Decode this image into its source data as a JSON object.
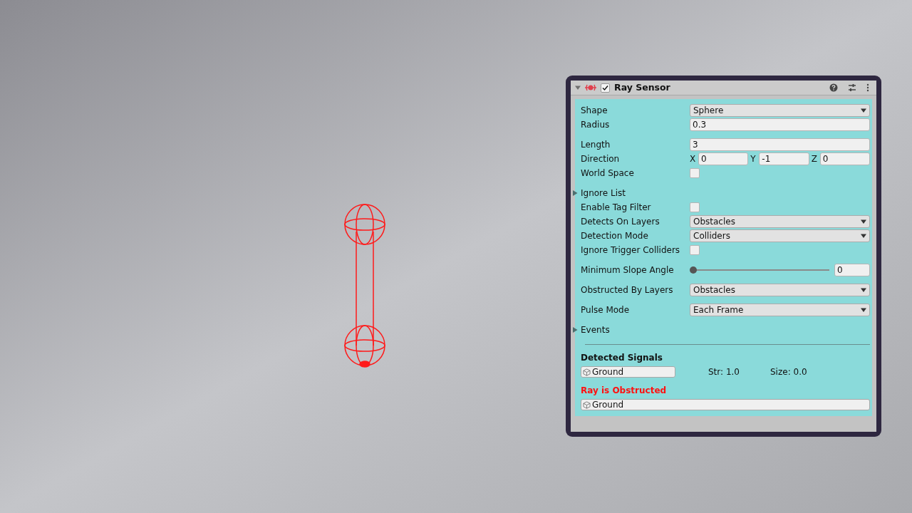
{
  "component": {
    "title": "Ray Sensor",
    "enabled": true,
    "expanded": true
  },
  "groups": [
    [
      {
        "kind": "dropdown",
        "label": "Shape",
        "value": "Sphere"
      },
      {
        "kind": "text",
        "label": "Radius",
        "value": "0.3"
      }
    ],
    [
      {
        "kind": "text",
        "label": "Length",
        "value": "3"
      },
      {
        "kind": "vector",
        "label": "Direction",
        "axes": [
          {
            "axis": "X",
            "value": "0"
          },
          {
            "axis": "Y",
            "value": "-1"
          },
          {
            "axis": "Z",
            "value": "0"
          }
        ]
      },
      {
        "kind": "checkbox",
        "label": "World Space",
        "checked": false
      }
    ],
    [
      {
        "kind": "foldout",
        "label": "Ignore List",
        "expanded": false
      },
      {
        "kind": "checkbox",
        "label": "Enable Tag Filter",
        "checked": false
      },
      {
        "kind": "dropdown",
        "label": "Detects On Layers",
        "value": "Obstacles"
      },
      {
        "kind": "dropdown",
        "label": "Detection Mode",
        "value": "Colliders"
      },
      {
        "kind": "checkbox",
        "label": "Ignore Trigger Colliders",
        "checked": false
      }
    ],
    [
      {
        "kind": "slider",
        "label": "Minimum Slope Angle",
        "level": 0,
        "value": "0"
      }
    ],
    [
      {
        "kind": "dropdown",
        "label": "Obstructed By Layers",
        "value": "Obstacles"
      }
    ],
    [
      {
        "kind": "dropdown",
        "label": "Pulse Mode",
        "value": "Each Frame"
      }
    ],
    [
      {
        "kind": "foldout",
        "label": "Events",
        "expanded": false
      }
    ]
  ],
  "detected": {
    "heading": "Detected Signals",
    "signals": [
      {
        "name": "Ground",
        "strength": "Str: 1.0",
        "size": "Size: 0.0"
      }
    ]
  },
  "obstruction": {
    "heading": "Ray is Obstructed",
    "object": "Ground"
  }
}
